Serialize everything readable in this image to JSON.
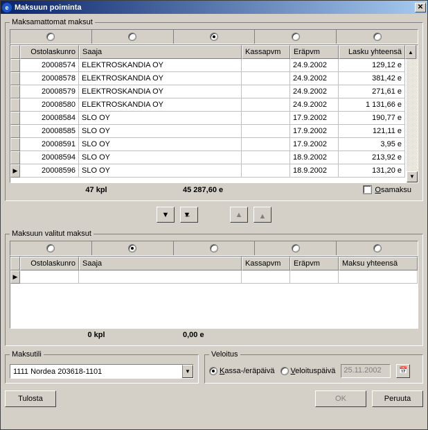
{
  "window": {
    "title": "Maksuun poiminta",
    "icon": "e"
  },
  "group_unpaid": {
    "legend": "Maksamattomat maksut"
  },
  "group_selected": {
    "legend": "Maksuun valitut maksut"
  },
  "columns": {
    "id": "Ostolaskunro",
    "payee": "Saaja",
    "kassa": "Kassapvm",
    "era": "Eräpvm",
    "amount_top": "Lasku yhteensä",
    "amount_bottom": "Maksu yhteensä"
  },
  "rows": [
    {
      "id": "20008574",
      "payee": "ELEKTROSKANDIA OY",
      "kassa": "",
      "era": "24.9.2002",
      "amount": "129,12 e"
    },
    {
      "id": "20008578",
      "payee": "ELEKTROSKANDIA OY",
      "kassa": "",
      "era": "24.9.2002",
      "amount": "381,42 e"
    },
    {
      "id": "20008579",
      "payee": "ELEKTROSKANDIA OY",
      "kassa": "",
      "era": "24.9.2002",
      "amount": "271,61 e"
    },
    {
      "id": "20008580",
      "payee": "ELEKTROSKANDIA OY",
      "kassa": "",
      "era": "24.9.2002",
      "amount": "1 131,66 e"
    },
    {
      "id": "20008584",
      "payee": "SLO OY",
      "kassa": "",
      "era": "17.9.2002",
      "amount": "190,77 e"
    },
    {
      "id": "20008585",
      "payee": "SLO OY",
      "kassa": "",
      "era": "17.9.2002",
      "amount": "121,11 e"
    },
    {
      "id": "20008591",
      "payee": "SLO OY",
      "kassa": "",
      "era": "17.9.2002",
      "amount": "3,95 e"
    },
    {
      "id": "20008594",
      "payee": "SLO OY",
      "kassa": "",
      "era": "18.9.2002",
      "amount": "213,92 e"
    },
    {
      "id": "20008596",
      "payee": "SLO OY",
      "kassa": "",
      "era": "18.9.2002",
      "amount": "131,20 e"
    }
  ],
  "totals_top": {
    "count": "47 kpl",
    "sum": "45 287,60 e"
  },
  "totals_bottom": {
    "count": "0 kpl",
    "sum": "0,00 e"
  },
  "osamaksu_label": "Osamaksu",
  "maksutili": {
    "legend": "Maksutili",
    "value": "1111 Nordea 203618-1101"
  },
  "veloitus": {
    "legend": "Veloitus",
    "opt1": "Kassa-/eräpäivä",
    "opt2": "Veloituspäivä",
    "date": "25.11.2002"
  },
  "buttons": {
    "print": "Tulosta",
    "ok": "OK",
    "cancel": "Peruuta"
  }
}
